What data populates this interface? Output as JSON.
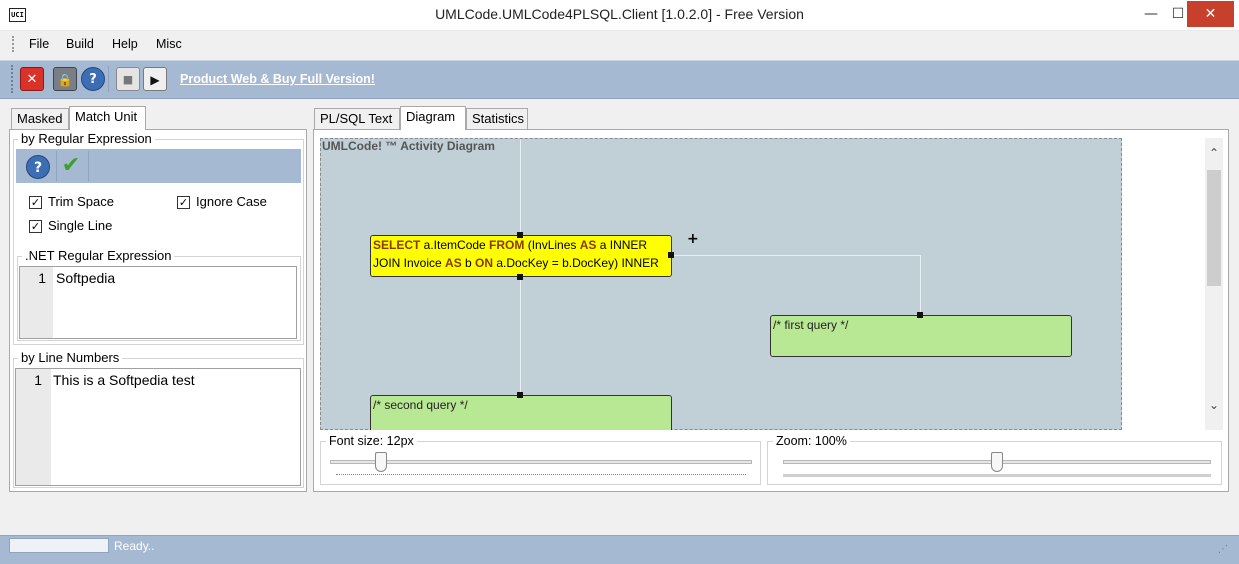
{
  "window": {
    "title": "UMLCode.UMLCode4PLSQL.Client [1.0.2.0] - Free Version",
    "icon_text": "UCI",
    "minimize": "—",
    "maximize": "☐",
    "close": "✕"
  },
  "menu": [
    "File",
    "Build",
    "Help",
    "Misc"
  ],
  "toolbar": {
    "exit": "✕",
    "lock": "🔒",
    "help": "?",
    "stop": "■",
    "run": "▶",
    "product_link": "Product Web & Buy Full Version!"
  },
  "left_tabs": [
    "Masked",
    "Match Unit"
  ],
  "regex_group": {
    "title": "by Regular Expression",
    "help": "?",
    "apply": "✔",
    "options": [
      {
        "label": "Trim Space",
        "checked": true
      },
      {
        "label": "Ignore Case",
        "checked": true
      },
      {
        "label": "Single Line",
        "checked": true
      }
    ],
    "net_label": ".NET Regular Expression",
    "line_no": "1",
    "expression": "Softpedia"
  },
  "line_group": {
    "title": "by Line Numbers",
    "line_no": "1",
    "text": "This is a Softpedia test"
  },
  "right_tabs": [
    "PL/SQL Text",
    "Diagram",
    "Statistics"
  ],
  "diagram": {
    "title": "UMLCode! ™ Activity Diagram",
    "plus": "+",
    "select_node": {
      "line1": [
        {
          "t": "SELECT",
          "kw": true
        },
        {
          "t": " a.ItemCode ",
          "kw": false
        },
        {
          "t": "FROM",
          "kw": true
        },
        {
          "t": " (InvLines ",
          "kw": false
        },
        {
          "t": "AS",
          "kw": true
        },
        {
          "t": " a INNER",
          "kw": false
        }
      ],
      "line2": [
        {
          "t": "JOIN Invoice ",
          "kw": false
        },
        {
          "t": "AS",
          "kw": true
        },
        {
          "t": " b ",
          "kw": false
        },
        {
          "t": "ON",
          "kw": true
        },
        {
          "t": " a.DocKey = b.DocKey) INNER",
          "kw": false
        }
      ]
    },
    "first_node": "/* first query */",
    "second_node": "/* second query */"
  },
  "scroll": {
    "up": "⌃",
    "down": "⌄"
  },
  "font_size": {
    "label": "Font size: 12px",
    "level": 0.12
  },
  "zoom": {
    "label": "Zoom: 100%",
    "level": 0.5
  },
  "status": {
    "text": "Ready.."
  },
  "colors": {
    "toolbar_blue": "#a6b9d2",
    "query_yellow": "#ffff00",
    "query_green": "#b9e894",
    "close_red": "#c7402b"
  }
}
